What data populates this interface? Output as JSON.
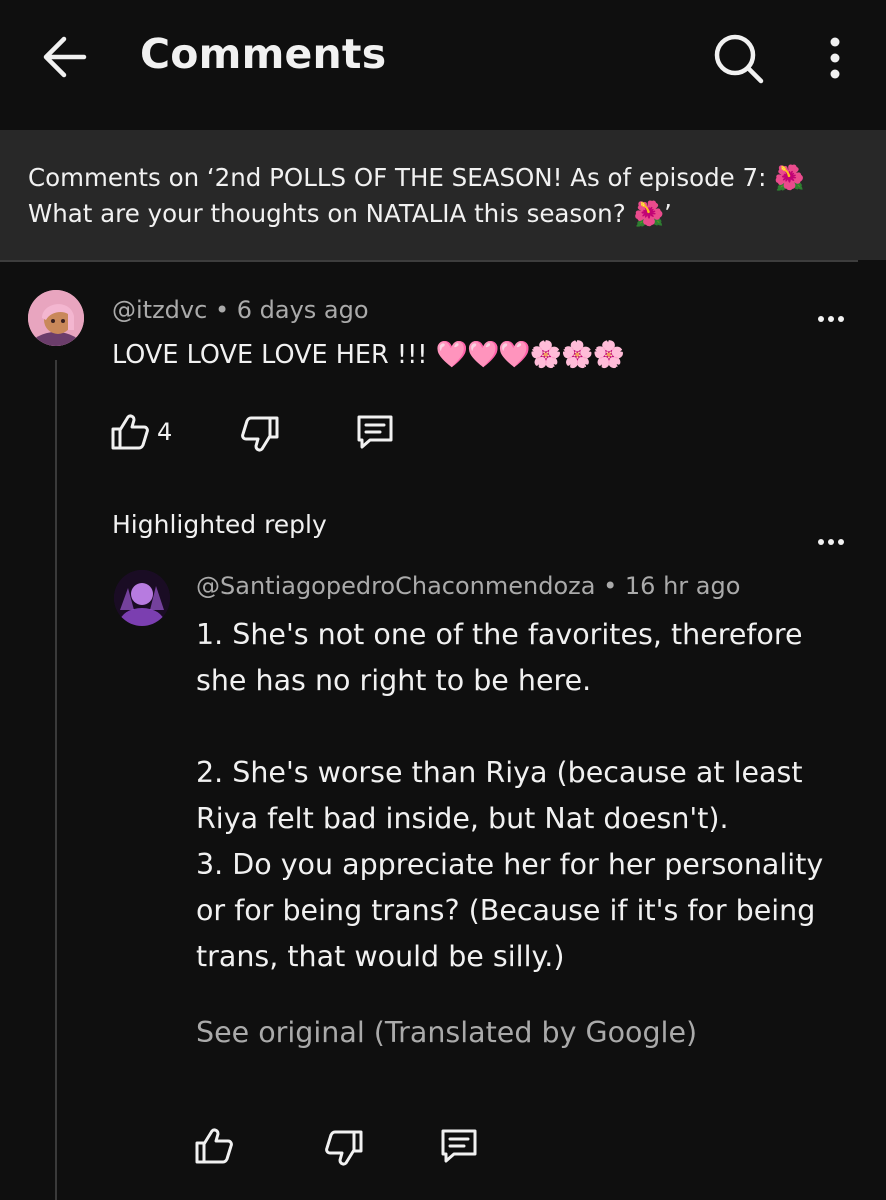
{
  "header": {
    "title": "Comments"
  },
  "context": {
    "text": "Comments on ‘2nd POLLS OF THE SEASON! As of episode 7: 🌺 What are your thoughts on NATALIA this season? 🌺’"
  },
  "comment": {
    "author": "@itzdvc",
    "time": "6 days ago",
    "text": "LOVE LOVE LOVE HER !!!",
    "emojis": "🩷🩷🩷🌸🌸🌸",
    "like_count": "4"
  },
  "highlighted_label": "Highlighted reply",
  "reply": {
    "author": "@SantiagopedroChaconmendoza",
    "time": "16 hr ago",
    "text": "1. She's not one of the favorites, therefore she has no right to be here.\n\n2. She's worse than Riya (because at least Riya felt bad inside, but Nat doesn't).\n3. Do you appreciate her for her personality or for being trans? (Because if it's for being trans, that would be silly.)",
    "see_original": "See original (Translated by Google)"
  },
  "icons": {
    "back": "back-arrow-icon",
    "search": "search-icon",
    "more": "more-vertical-icon",
    "comment_more": "more-horizontal-icon",
    "like": "thumbs-up-icon",
    "dislike": "thumbs-down-icon",
    "reply": "reply-comment-icon"
  },
  "colors": {
    "background": "#0f0f0f",
    "context_bar": "#282828",
    "secondary_text": "#aaaaaa",
    "primary_text": "#f1f1f1"
  }
}
